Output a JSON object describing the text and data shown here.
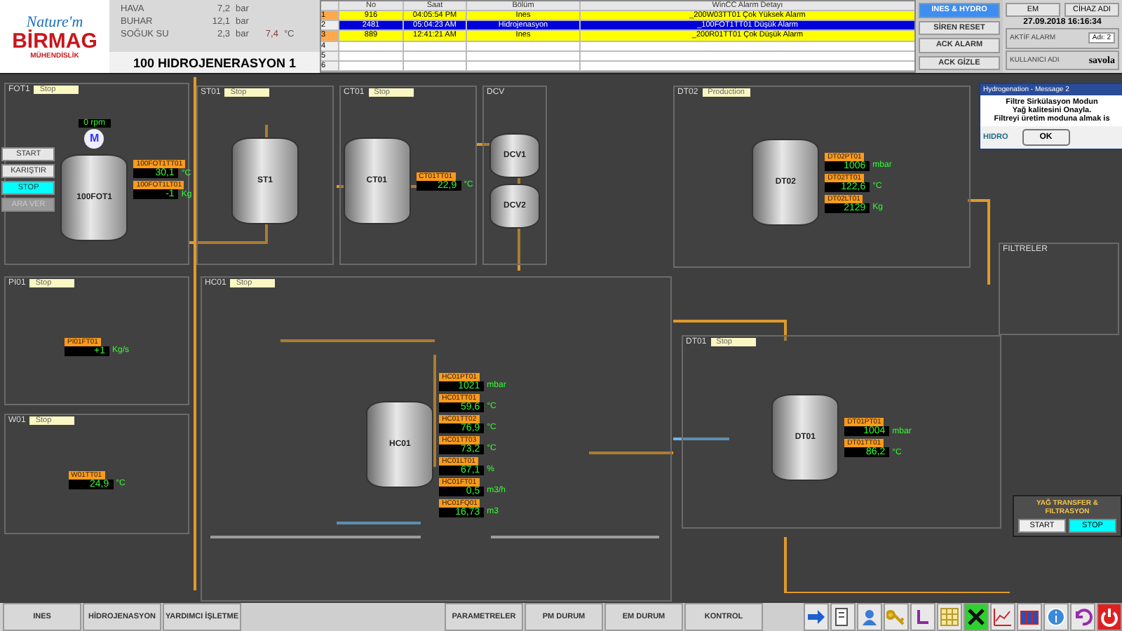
{
  "header": {
    "logo_top": "Nature'm",
    "logo_main": "BİRMAG",
    "logo_sub": "MÜHENDİSLİK",
    "utilities": [
      {
        "label": "HAVA",
        "value": "7,2",
        "unit": "bar"
      },
      {
        "label": "BUHAR",
        "value": "12,1",
        "unit": "bar"
      },
      {
        "label": "SOĞUK SU",
        "value": "2,3",
        "unit": "bar",
        "extra_value": "7,4",
        "extra_unit": "°C"
      }
    ],
    "title": "100 HIDROJENERASYON 1"
  },
  "alarms": {
    "columns": [
      "No",
      "Saat",
      "Bölüm",
      "WinCC Alarm Detayı"
    ],
    "rows": [
      {
        "index": "1",
        "no": "916",
        "time": "04:05:54 PM",
        "area": "Ines",
        "detail": "_200W03TT01  Çok Yüksek Alarm",
        "selected": false
      },
      {
        "index": "2",
        "no": "2481",
        "time": "05:04:23 AM",
        "area": "Hidrojenasyon",
        "detail": "_100FOT1TT01  Düşük Alarm",
        "selected": true
      },
      {
        "index": "3",
        "no": "889",
        "time": "12:41:21 AM",
        "area": "Ines",
        "detail": "_200R01TT01  Çok Düşük Alarm",
        "selected": false
      },
      {
        "index": "4",
        "selected": false
      },
      {
        "index": "5",
        "selected": false
      },
      {
        "index": "6",
        "selected": false
      }
    ]
  },
  "actions": [
    {
      "label": "INES & HYDRO",
      "selected": true
    },
    {
      "label": "SİREN RESET",
      "selected": false
    },
    {
      "label": "ACK ALARM",
      "selected": false
    },
    {
      "label": "ACK GİZLE",
      "selected": false
    }
  ],
  "session": {
    "buttons": [
      "EM",
      "CİHAZ ADI"
    ],
    "datetime": "27.09.2018 16:16:34",
    "active_alarm_label": "AKTİF ALARM",
    "alarm_name_label": "Adı:",
    "alarm_count": "2",
    "user_label": "KULLANICI ADI",
    "user": "savola"
  },
  "plant": {
    "sections": [
      {
        "name": "FOT1",
        "status": "Stop",
        "vessels": [
          "100FOT1"
        ],
        "motor": {
          "symbol": "M",
          "speed": "0 rpm"
        },
        "readings": [
          {
            "tag": "100FOT1TT01",
            "value": "30,1",
            "unit": "°C"
          },
          {
            "tag": "100FOT1LT01",
            "value": "-1",
            "unit": "Kg"
          }
        ],
        "controls": [
          {
            "label": "START",
            "selected": false,
            "disabled": false
          },
          {
            "label": "KARIŞTIR",
            "selected": false,
            "disabled": false
          },
          {
            "label": "STOP",
            "selected": true,
            "disabled": false
          },
          {
            "label": "ARA VER",
            "selected": false,
            "disabled": true
          }
        ]
      },
      {
        "name": "ST01",
        "status": "Stop",
        "vessels": [
          "ST1"
        ]
      },
      {
        "name": "CT01",
        "status": "Stop",
        "vessels": [
          "CT01"
        ],
        "readings": [
          {
            "tag": "CT01TT01",
            "value": "22,9",
            "unit": "°C"
          }
        ]
      },
      {
        "name": "DCV",
        "vessels": [
          "DCV1",
          "DCV2"
        ]
      },
      {
        "name": "DT02",
        "status": "Production",
        "vessels": [
          "DT02"
        ],
        "readings": [
          {
            "tag": "DT02PT01",
            "value": "1006",
            "unit": "mbar"
          },
          {
            "tag": "DT02TT01",
            "value": "122,6",
            "unit": "°C"
          },
          {
            "tag": "DT02LT01",
            "value": "2129",
            "unit": "Kg"
          }
        ]
      },
      {
        "name": "PI01",
        "status": "Stop",
        "readings": [
          {
            "tag": "PI01FT01",
            "value": "+1",
            "unit": "Kg/s"
          }
        ]
      },
      {
        "name": "W01",
        "status": "Stop",
        "readings": [
          {
            "tag": "W01TT01",
            "value": "24,9",
            "unit": "°C"
          }
        ]
      },
      {
        "name": "HC01",
        "status": "Stop",
        "vessels": [
          "HC01"
        ],
        "readings": [
          {
            "tag": "HC01PT01",
            "value": "1021",
            "unit": "mbar"
          },
          {
            "tag": "HC01TT01",
            "value": "59,6",
            "unit": "°C"
          },
          {
            "tag": "HC01TT02",
            "value": "76,9",
            "unit": "°C"
          },
          {
            "tag": "HC01TT03",
            "value": "73,2",
            "unit": "°C"
          },
          {
            "tag": "HC01LT01",
            "value": "67,1",
            "unit": "%"
          },
          {
            "tag": "HC01FT01",
            "value": "0,5",
            "unit": "m3/h"
          },
          {
            "tag": "HC01FQ01",
            "value": "16,73",
            "unit": "m3"
          }
        ]
      },
      {
        "name": "DT01",
        "status": "Stop",
        "vessels": [
          "DT01"
        ],
        "readings": [
          {
            "tag": "DT01PT01",
            "value": "1004",
            "unit": "mbar"
          },
          {
            "tag": "DT01TT01",
            "value": "86,2",
            "unit": "°C"
          }
        ]
      },
      {
        "name": "FILTRELER"
      }
    ]
  },
  "transfer": {
    "title": "YAĞ TRANSFER & FILTRASYON",
    "buttons": [
      {
        "label": "START",
        "selected": false
      },
      {
        "label": "STOP",
        "selected": true
      }
    ]
  },
  "popup": {
    "title": "Hydrogenation - Message 2",
    "lines": [
      "Filtre Sirkülasyon Modun",
      "Yağ kalitesini Onayla.",
      "Filtreyi üretim moduna almak is"
    ],
    "footer": "HIDRO",
    "button": "OK"
  },
  "nav": {
    "buttons": [
      "INES",
      "HİDROJENASYON",
      "YARDIMCI İŞLETME",
      "PARAMETRELER",
      "PM DURUM",
      "EM DURUM",
      "KONTROL"
    ]
  }
}
